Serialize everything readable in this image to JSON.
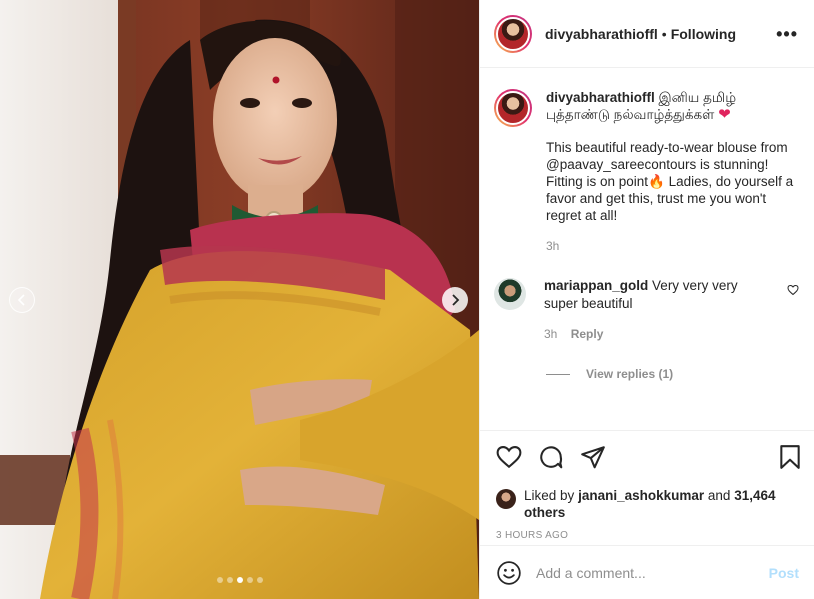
{
  "post": {
    "username": "divyabharathioffl",
    "follow_status": "Following",
    "more_label": "•••",
    "separator": "•"
  },
  "caption": {
    "username": "divyabharathioffl",
    "title_text": "இனிய தமிழ் புத்தாண்டு நல்வாழ்த்துக்கள்",
    "title_emoji": "❤",
    "body": "This beautiful ready-to-wear blouse from @paavay_sareecontours is stunning! Fitting is on point🔥 Ladies, do yourself a favor and get this, trust me you won't regret at all!",
    "time": "3h"
  },
  "comments": [
    {
      "username": "mariappan_gold",
      "text": "Very very very super beautiful",
      "time": "3h",
      "reply_label": "Reply",
      "view_replies": "View replies (1)"
    }
  ],
  "likes": {
    "prefix": "Liked by",
    "liker": "janani_ashokkumar",
    "middle": "and",
    "others": "31,464 others"
  },
  "timestamp": "3 HOURS AGO",
  "composer": {
    "placeholder": "Add a comment...",
    "post_label": "Post"
  },
  "carousel": {
    "total": 5,
    "active": 2
  },
  "colors": {
    "accent_blue": "#0095f6",
    "post_disabled": "#b2dffc",
    "heart_red": "#e0245e",
    "muted": "#8e8e8e"
  }
}
